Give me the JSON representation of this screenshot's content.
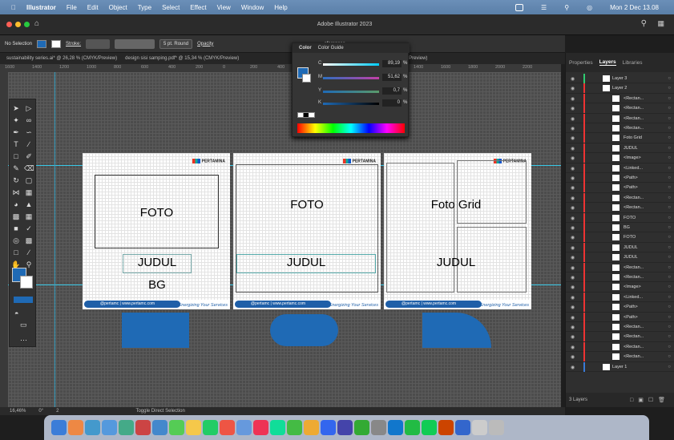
{
  "menubar": {
    "apple_icon": "apple-icon",
    "app_name": "Illustrator",
    "items": [
      "File",
      "Edit",
      "Object",
      "Type",
      "Select",
      "Effect",
      "View",
      "Window",
      "Help"
    ],
    "clock": "Mon 2 Dec  13.08"
  },
  "window": {
    "title": "Adobe Illustrator 2023"
  },
  "control_bar": {
    "selection": "No Selection",
    "stroke_label": "Stroke:",
    "brush": "5 pt. Round",
    "opacity_label": "Opacity",
    "preferences_label": "eferences"
  },
  "doc_tabs": [
    "sustainability series.ai* @ 26,28 % (CMYK/Preview)",
    "design sisi samping.pdf* @ 15,34 % (CMYK/Preview)",
    "osai @ 30,7 % (CMYK/Preview)"
  ],
  "ruler_ticks": [
    "1600",
    "1400",
    "1200",
    "1000",
    "800",
    "600",
    "400",
    "200",
    "0",
    "200",
    "400",
    "600",
    "800",
    "1000",
    "1200",
    "1400",
    "1600",
    "1800",
    "2000",
    "2200"
  ],
  "color_panel": {
    "tabs": [
      "Color",
      "Color Guide"
    ],
    "channels": [
      {
        "label": "C",
        "value": "89,19",
        "unit": "%"
      },
      {
        "label": "M",
        "value": "51,62",
        "unit": "%"
      },
      {
        "label": "Y",
        "value": "0,7",
        "unit": "%"
      },
      {
        "label": "K",
        "value": "0",
        "unit": "%"
      }
    ],
    "fill_color": "#1f6ab5"
  },
  "artboards": [
    {
      "label_foto": "FOTO",
      "label_judul": "JUDUL",
      "label_bg": "BG"
    },
    {
      "label_foto": "FOTO",
      "label_judul": "JUDUL"
    },
    {
      "label_foto": "Foto Grid",
      "label_judul": "JUDUL"
    }
  ],
  "brand": {
    "logo_text": "PERTAMINA",
    "footer_text": "@pertamc | www.pertamc.com",
    "tagline": "Energizing Your Services",
    "blue": "#1f6ab5"
  },
  "right_panel": {
    "tabs": [
      "Properties",
      "Layers",
      "Libraries"
    ],
    "layers": [
      {
        "name": "Layer 3",
        "level": 0
      },
      {
        "name": "Layer 2",
        "level": 0
      },
      {
        "name": "<Rectan...",
        "level": 1
      },
      {
        "name": "<Rectan...",
        "level": 1
      },
      {
        "name": "<Rectan...",
        "level": 1
      },
      {
        "name": "<Rectan...",
        "level": 1
      },
      {
        "name": "Foto Grid",
        "level": 1
      },
      {
        "name": "JUDUL",
        "level": 1
      },
      {
        "name": "<Image>",
        "level": 1
      },
      {
        "name": "<Linked...",
        "level": 1
      },
      {
        "name": "<Path>",
        "level": 1
      },
      {
        "name": "<Path>",
        "level": 1
      },
      {
        "name": "<Rectan...",
        "level": 1
      },
      {
        "name": "<Rectan...",
        "level": 1
      },
      {
        "name": "FOTO",
        "level": 1
      },
      {
        "name": "BG",
        "level": 1
      },
      {
        "name": "FOTO",
        "level": 1
      },
      {
        "name": "JUDUL",
        "level": 1
      },
      {
        "name": "JUDUL",
        "level": 1
      },
      {
        "name": "<Rectan...",
        "level": 1
      },
      {
        "name": "<Rectan...",
        "level": 1
      },
      {
        "name": "<Image>",
        "level": 1
      },
      {
        "name": "<Linked...",
        "level": 1
      },
      {
        "name": "<Path>",
        "level": 1
      },
      {
        "name": "<Path>",
        "level": 1
      },
      {
        "name": "<Rectan...",
        "level": 1
      },
      {
        "name": "<Rectan...",
        "level": 1
      },
      {
        "name": "<Rectan...",
        "level": 1
      },
      {
        "name": "<Rectan...",
        "level": 1
      },
      {
        "name": "Layer 1",
        "level": 0
      }
    ],
    "footer_count": "3 Layers"
  },
  "status_bar": {
    "zoom": "16,46%",
    "rotation": "0°",
    "artboard_nav": "2",
    "tool_hint": "Toggle Direct Selection"
  },
  "dock_colors": [
    "#3b7dd8",
    "#e84",
    "#49c",
    "#59d",
    "#4a8",
    "#c44",
    "#48c",
    "#5c5",
    "#f5c84a",
    "#2c6",
    "#e54",
    "#69d",
    "#e35",
    "#1d9",
    "#4b4",
    "#ea3",
    "#36e",
    "#44a",
    "#3a3",
    "#888",
    "#17c",
    "#2b4",
    "#1c5",
    "#c40",
    "#36c",
    "#ccc",
    "#bbb"
  ]
}
